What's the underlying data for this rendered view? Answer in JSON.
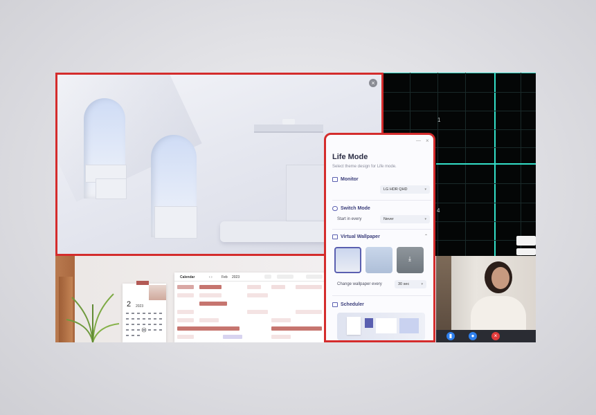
{
  "dialog": {
    "title": "Life Mode",
    "subtitle": "Select theme design for Life mode.",
    "monitor": {
      "label": "Monitor",
      "value": "LG HDR QHD"
    },
    "switch_mode": {
      "label": "Switch Mode",
      "start_label": "Start in every",
      "start_value": "Never"
    },
    "virtual_wallpaper": {
      "label": "Virtual Wallpaper",
      "change_label": "Change wallpaper every",
      "change_value": "30 sec"
    },
    "scheduler": {
      "label": "Scheduler"
    }
  },
  "grid": {
    "label_1": "1",
    "label_4": "4"
  },
  "mini_calendar": {
    "day": "2",
    "year": "2023"
  },
  "calendar": {
    "title": "Calendar",
    "month": "Feb",
    "year": "2023"
  },
  "colors": {
    "highlight": "#d42c2c",
    "accent": "#3a3d7a",
    "grid_line": "#33e0c9"
  }
}
